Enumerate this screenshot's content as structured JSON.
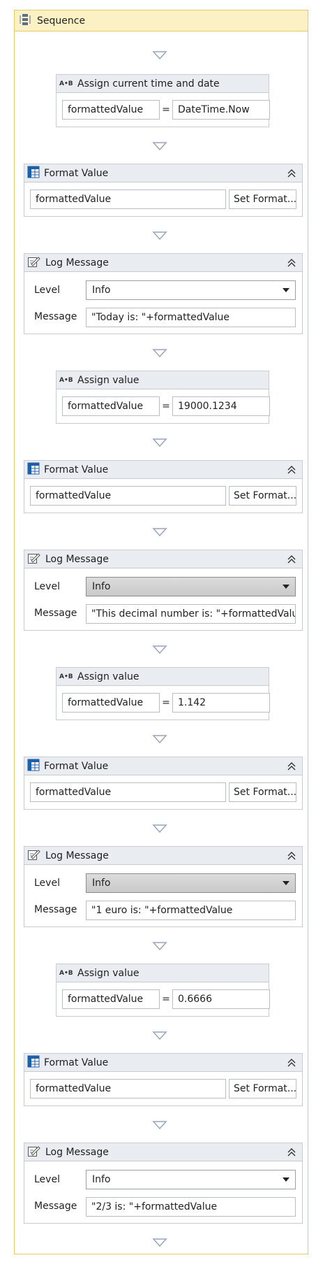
{
  "sequence": {
    "title": "Sequence"
  },
  "activities": [
    {
      "type": "assign",
      "title": "Assign current time and date",
      "left": "formattedValue",
      "right": "DateTime.Now"
    },
    {
      "type": "format",
      "title": "Format Value",
      "variable": "formattedValue",
      "button": "Set Format..."
    },
    {
      "type": "log",
      "title": "Log Message",
      "level_label": "Level",
      "level": "Info",
      "message_label": "Message",
      "message": "\"Today is: \"+formattedValue",
      "highlight": false
    },
    {
      "type": "assign",
      "title": "Assign value",
      "left": "formattedValue",
      "right": "19000.1234"
    },
    {
      "type": "format",
      "title": "Format Value",
      "variable": "formattedValue",
      "button": "Set Format..."
    },
    {
      "type": "log",
      "title": "Log Message",
      "level_label": "Level",
      "level": "Info",
      "message_label": "Message",
      "message": "\"This decimal number is: \"+formattedValue",
      "highlight": true
    },
    {
      "type": "assign",
      "title": "Assign value",
      "left": "formattedValue",
      "right": "1.142"
    },
    {
      "type": "format",
      "title": "Format Value",
      "variable": "formattedValue",
      "button": "Set Format..."
    },
    {
      "type": "log",
      "title": "Log Message",
      "level_label": "Level",
      "level": "Info",
      "message_label": "Message",
      "message": "\"1 euro is: \"+formattedValue",
      "highlight": true
    },
    {
      "type": "assign",
      "title": "Assign value",
      "left": "formattedValue",
      "right": "0.6666"
    },
    {
      "type": "format",
      "title": "Format Value",
      "variable": "formattedValue",
      "button": "Set Format..."
    },
    {
      "type": "log",
      "title": "Log Message",
      "level_label": "Level",
      "level": "Info",
      "message_label": "Message",
      "message": "\"2/3 is: \"+formattedValue",
      "highlight": false
    }
  ],
  "icons": {
    "assign": "assign-ab-icon",
    "format": "format-value-grid-icon",
    "log": "log-message-icon",
    "sequence": "sequence-icon",
    "collapse": "collapse-chevron-icon",
    "arrow": "drop-arrow-icon"
  },
  "colors": {
    "sequence_header": "#fcf1c4",
    "sequence_border": "#e2c96b",
    "activity_header": "#e9ecf0"
  }
}
